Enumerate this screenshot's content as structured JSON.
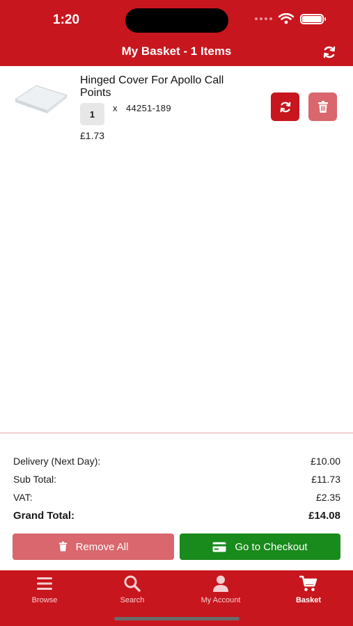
{
  "status_bar": {
    "time": "1:20"
  },
  "header": {
    "title": "My Basket - 1 Items",
    "refresh_icon": "refresh-icon"
  },
  "basket": {
    "items": [
      {
        "name": "Hinged Cover For Apollo Call Points",
        "quantity": "1",
        "times": "x",
        "sku": "44251-189",
        "price": "£1.73"
      }
    ]
  },
  "totals": {
    "delivery_label": "Delivery (Next Day):",
    "delivery_value": "£10.00",
    "subtotal_label": "Sub Total:",
    "subtotal_value": "£11.73",
    "vat_label": "VAT:",
    "vat_value": "£2.35",
    "grand_label": "Grand Total:",
    "grand_value": "£14.08"
  },
  "actions": {
    "remove_all_label": "Remove All",
    "checkout_label": "Go to Checkout"
  },
  "tabs": [
    {
      "label": "Browse",
      "icon": "menu-icon"
    },
    {
      "label": "Search",
      "icon": "search-icon"
    },
    {
      "label": "My Account",
      "icon": "user-icon"
    },
    {
      "label": "Basket",
      "icon": "cart-icon",
      "active": true
    }
  ],
  "colors": {
    "brand_red": "#c8161e",
    "muted_red": "#d9676d",
    "checkout_green": "#198a1c"
  }
}
